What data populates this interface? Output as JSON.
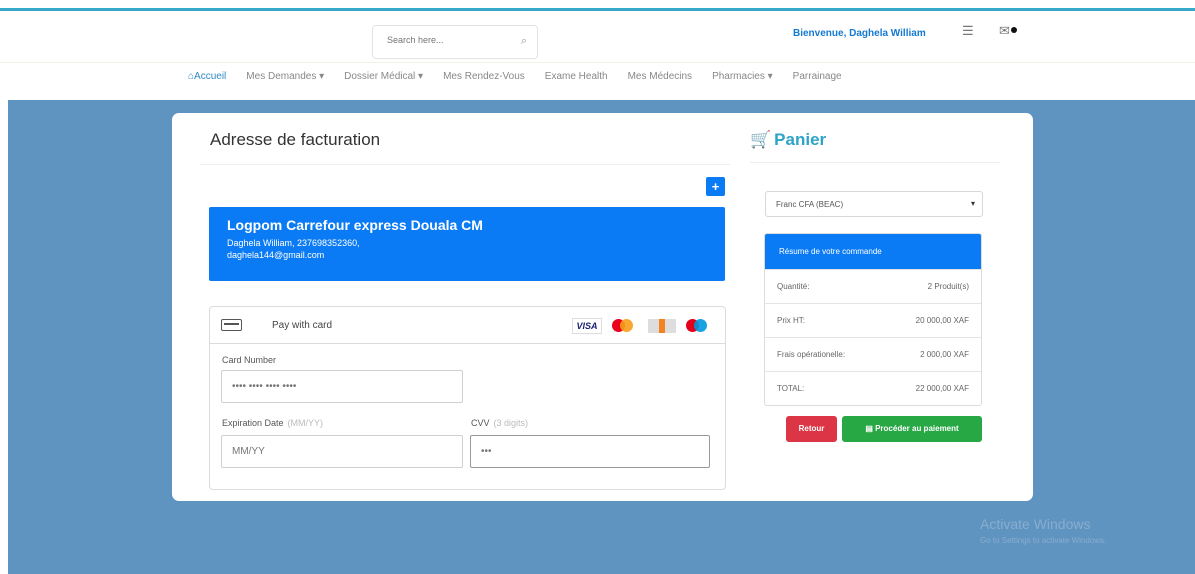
{
  "header": {
    "search_placeholder": "Search here...",
    "welcome": "Bienvenue, Daghela William"
  },
  "nav": {
    "items": [
      {
        "label": "Accueil",
        "icon": "home-icon"
      },
      {
        "label": "Mes Demandes ▾"
      },
      {
        "label": "Dossier Médical ▾"
      },
      {
        "label": "Mes Rendez-Vous"
      },
      {
        "label": "Exame Health"
      },
      {
        "label": "Mes Médecins"
      },
      {
        "label": "Pharmacies ▾"
      },
      {
        "label": "Parrainage"
      }
    ]
  },
  "billing": {
    "title": "Adresse de facturation",
    "add_label": "+",
    "address": {
      "name": "Logpom Carrefour express Douala CM",
      "line1": "Daghela William, 237698352360,",
      "line2": "daghela144@gmail.com"
    }
  },
  "payment": {
    "header_label": "Pay with card",
    "card_number_label": "Card Number",
    "card_number_placeholder": "•••• •••• •••• ••••",
    "expiration_label": "Expiration Date",
    "expiration_hint": "(MM/YY)",
    "expiration_placeholder": "MM/YY",
    "cvv_label": "CVV",
    "cvv_hint": "(3 digits)",
    "cvv_value": "•••",
    "brands": {
      "visa": "VISA"
    }
  },
  "cart": {
    "title": "Panier",
    "currency": "Franc CFA (BEAC)",
    "summary_title": "Résume de votre commande",
    "rows": [
      {
        "label": "Quantité:",
        "value": "2 Produit(s)"
      },
      {
        "label": "Prix HT:",
        "value": "20 000,00 XAF"
      },
      {
        "label": "Frais opérationelle:",
        "value": "2 000,00 XAF"
      },
      {
        "label": "TOTAL:",
        "value": "22 000,00 XAF"
      }
    ],
    "back_label": "Retour",
    "proceed_label": "Procéder au paiement"
  },
  "watermark": {
    "line1": "Activate Windows",
    "line2": "Go to Settings to activate Windows."
  },
  "colors": {
    "primary": "#0b7bf5",
    "background": "#5f93c0",
    "danger": "#dc3545",
    "success": "#28a745",
    "accent": "#2da3c7"
  }
}
